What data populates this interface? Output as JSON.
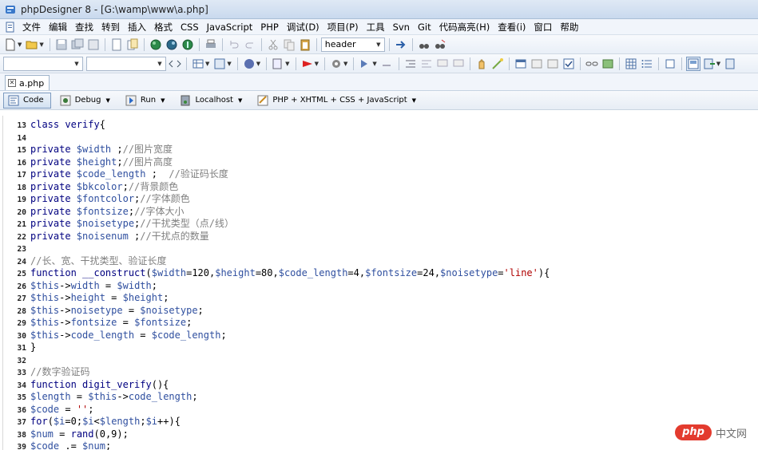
{
  "window": {
    "title": "phpDesigner 8 - [G:\\wamp\\www\\a.php]"
  },
  "menu": [
    "文件",
    "编辑",
    "查找",
    "转到",
    "插入",
    "格式",
    "CSS",
    "JavaScript",
    "PHP",
    "调试(D)",
    "项目(P)",
    "工具",
    "Svn",
    "Git",
    "代码高亮(H)",
    "查看(i)",
    "窗口",
    "帮助"
  ],
  "toolbar": {
    "header_combo": "header"
  },
  "tabs": [
    {
      "label": "a.php"
    }
  ],
  "runbar": {
    "code": "Code",
    "debug": "Debug",
    "run": "Run",
    "localhost": "Localhost",
    "highlighter": "PHP + XHTML + CSS + JavaScript"
  },
  "code_lines": [
    {
      "n": "13",
      "tokens": [
        [
          "kw",
          "class "
        ],
        [
          "fn",
          "verify"
        ],
        [
          "pl",
          "{"
        ]
      ]
    },
    {
      "n": "14",
      "tokens": []
    },
    {
      "n": "15",
      "tokens": [
        [
          "kw",
          "private "
        ],
        [
          "var",
          "$width"
        ],
        [
          "pl",
          " ;"
        ],
        [
          "cm",
          "//图片宽度"
        ]
      ]
    },
    {
      "n": "16",
      "tokens": [
        [
          "kw",
          "private "
        ],
        [
          "var",
          "$height"
        ],
        [
          "pl",
          ";"
        ],
        [
          "cm",
          "//图片高度"
        ]
      ]
    },
    {
      "n": "17",
      "tokens": [
        [
          "kw",
          "private "
        ],
        [
          "var",
          "$code_length"
        ],
        [
          "pl",
          " ;  "
        ],
        [
          "cm",
          "//验证码长度"
        ]
      ]
    },
    {
      "n": "18",
      "tokens": [
        [
          "kw",
          "private "
        ],
        [
          "var",
          "$bkcolor"
        ],
        [
          "pl",
          ";"
        ],
        [
          "cm",
          "//背景颜色"
        ]
      ]
    },
    {
      "n": "19",
      "tokens": [
        [
          "kw",
          "private "
        ],
        [
          "var",
          "$fontcolor"
        ],
        [
          "pl",
          ";"
        ],
        [
          "cm",
          "//字体颜色"
        ]
      ]
    },
    {
      "n": "20",
      "tokens": [
        [
          "kw",
          "private "
        ],
        [
          "var",
          "$fontsize"
        ],
        [
          "pl",
          ";"
        ],
        [
          "cm",
          "//字体大小"
        ]
      ]
    },
    {
      "n": "21",
      "tokens": [
        [
          "kw",
          "private "
        ],
        [
          "var",
          "$noisetype"
        ],
        [
          "pl",
          ";"
        ],
        [
          "cm",
          "//干扰类型（点/线）"
        ]
      ]
    },
    {
      "n": "22",
      "tokens": [
        [
          "kw",
          "private "
        ],
        [
          "var",
          "$noisenum"
        ],
        [
          "pl",
          " ;"
        ],
        [
          "cm",
          "//干扰点的数量"
        ]
      ]
    },
    {
      "n": "23",
      "tokens": []
    },
    {
      "n": "24",
      "tokens": [
        [
          "cm",
          "//长、宽、干扰类型、验证长度"
        ]
      ]
    },
    {
      "n": "25",
      "tokens": [
        [
          "kw",
          "function "
        ],
        [
          "fn",
          "__construct"
        ],
        [
          "pl",
          "("
        ],
        [
          "var",
          "$width"
        ],
        [
          "pl",
          "=120,"
        ],
        [
          "var",
          "$height"
        ],
        [
          "pl",
          "=80,"
        ],
        [
          "var",
          "$code_length"
        ],
        [
          "pl",
          "=4,"
        ],
        [
          "var",
          "$fontsize"
        ],
        [
          "pl",
          "=24,"
        ],
        [
          "var",
          "$noisetype"
        ],
        [
          "pl",
          "="
        ],
        [
          "str",
          "'line'"
        ],
        [
          "pl",
          "){"
        ]
      ]
    },
    {
      "n": "26",
      "tokens": [
        [
          "var",
          "$this"
        ],
        [
          "pl",
          "->"
        ],
        [
          "var",
          "width"
        ],
        [
          "pl",
          " = "
        ],
        [
          "var",
          "$width"
        ],
        [
          "pl",
          ";"
        ]
      ]
    },
    {
      "n": "27",
      "tokens": [
        [
          "var",
          "$this"
        ],
        [
          "pl",
          "->"
        ],
        [
          "var",
          "height"
        ],
        [
          "pl",
          " = "
        ],
        [
          "var",
          "$height"
        ],
        [
          "pl",
          ";"
        ]
      ]
    },
    {
      "n": "28",
      "tokens": [
        [
          "var",
          "$this"
        ],
        [
          "pl",
          "->"
        ],
        [
          "var",
          "noisetype"
        ],
        [
          "pl",
          " = "
        ],
        [
          "var",
          "$noisetype"
        ],
        [
          "pl",
          ";"
        ]
      ]
    },
    {
      "n": "29",
      "tokens": [
        [
          "var",
          "$this"
        ],
        [
          "pl",
          "->"
        ],
        [
          "var",
          "fontsize"
        ],
        [
          "pl",
          " = "
        ],
        [
          "var",
          "$fontsize"
        ],
        [
          "pl",
          ";"
        ]
      ]
    },
    {
      "n": "30",
      "tokens": [
        [
          "var",
          "$this"
        ],
        [
          "pl",
          "->"
        ],
        [
          "var",
          "code_length"
        ],
        [
          "pl",
          " = "
        ],
        [
          "var",
          "$code_length"
        ],
        [
          "pl",
          ";"
        ]
      ]
    },
    {
      "n": "31",
      "tokens": [
        [
          "pl",
          "}"
        ]
      ]
    },
    {
      "n": "32",
      "tokens": []
    },
    {
      "n": "33",
      "tokens": [
        [
          "cm",
          "//数字验证码"
        ]
      ]
    },
    {
      "n": "34",
      "tokens": [
        [
          "kw",
          "function "
        ],
        [
          "fn",
          "digit_verify"
        ],
        [
          "pl",
          "(){"
        ]
      ]
    },
    {
      "n": "35",
      "tokens": [
        [
          "var",
          "$length"
        ],
        [
          "pl",
          " = "
        ],
        [
          "var",
          "$this"
        ],
        [
          "pl",
          "->"
        ],
        [
          "var",
          "code_length"
        ],
        [
          "pl",
          ";"
        ]
      ]
    },
    {
      "n": "36",
      "tokens": [
        [
          "var",
          "$code"
        ],
        [
          "pl",
          " = "
        ],
        [
          "str",
          "''"
        ],
        [
          "pl",
          ";"
        ]
      ]
    },
    {
      "n": "37",
      "tokens": [
        [
          "kw",
          "for"
        ],
        [
          "pl",
          "("
        ],
        [
          "var",
          "$i"
        ],
        [
          "pl",
          "=0;"
        ],
        [
          "var",
          "$i"
        ],
        [
          "pl",
          "<"
        ],
        [
          "var",
          "$length"
        ],
        [
          "pl",
          ";"
        ],
        [
          "var",
          "$i"
        ],
        [
          "pl",
          "++){"
        ]
      ]
    },
    {
      "n": "38",
      "tokens": [
        [
          "var",
          "$num"
        ],
        [
          "pl",
          " = "
        ],
        [
          "fn",
          "rand"
        ],
        [
          "pl",
          "(0,9);"
        ]
      ]
    },
    {
      "n": "39",
      "tokens": [
        [
          "var",
          "$code"
        ],
        [
          "pl",
          " .= "
        ],
        [
          "var",
          "$num"
        ],
        [
          "pl",
          ";"
        ]
      ]
    }
  ],
  "watermark": {
    "badge": "php",
    "text": "中文网"
  }
}
